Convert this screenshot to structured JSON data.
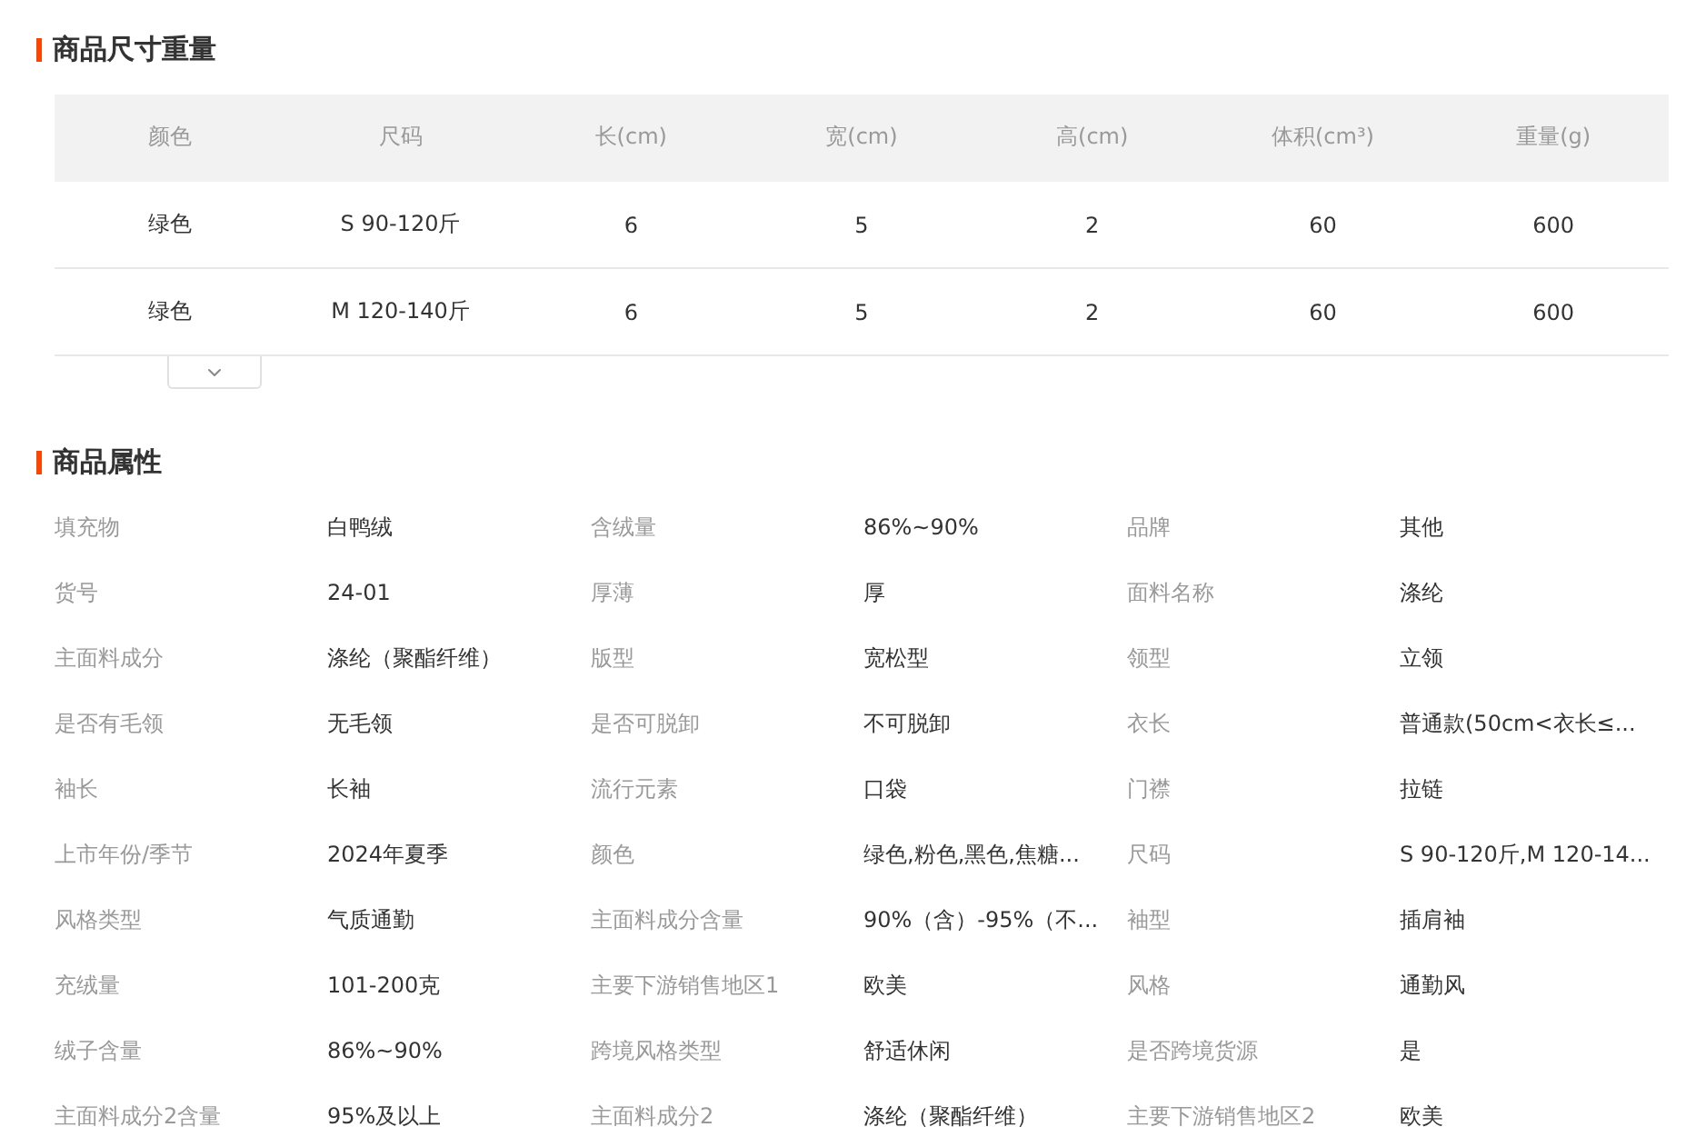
{
  "size_section": {
    "title": "商品尺寸重量",
    "table": {
      "columns": [
        "颜色",
        "尺码",
        "长(cm)",
        "宽(cm)",
        "高(cm)",
        "体积(cm³)",
        "重量(g)"
      ],
      "rows": [
        [
          "绿色",
          "S 90-120斤",
          "6",
          "5",
          "2",
          "60",
          "600"
        ],
        [
          "绿色",
          "M 120-140斤",
          "6",
          "5",
          "2",
          "60",
          "600"
        ]
      ]
    }
  },
  "attributes_section": {
    "title": "商品属性",
    "items": [
      {
        "label": "填充物",
        "value": "白鸭绒"
      },
      {
        "label": "含绒量",
        "value": "86%~90%"
      },
      {
        "label": "品牌",
        "value": "其他"
      },
      {
        "label": "货号",
        "value": "24-01"
      },
      {
        "label": "厚薄",
        "value": "厚"
      },
      {
        "label": "面料名称",
        "value": "涤纶"
      },
      {
        "label": "主面料成分",
        "value": "涤纶（聚酯纤维）"
      },
      {
        "label": "版型",
        "value": "宽松型"
      },
      {
        "label": "领型",
        "value": "立领"
      },
      {
        "label": "是否有毛领",
        "value": "无毛领"
      },
      {
        "label": "是否可脱卸",
        "value": "不可脱卸"
      },
      {
        "label": "衣长",
        "value": "普通款(50cm<衣长≤..."
      },
      {
        "label": "袖长",
        "value": "长袖"
      },
      {
        "label": "流行元素",
        "value": "口袋"
      },
      {
        "label": "门襟",
        "value": "拉链"
      },
      {
        "label": "上市年份/季节",
        "value": "2024年夏季"
      },
      {
        "label": "颜色",
        "value": "绿色,粉色,黑色,焦糖..."
      },
      {
        "label": "尺码",
        "value": "S 90-120斤,M 120-14..."
      },
      {
        "label": "风格类型",
        "value": "气质通勤"
      },
      {
        "label": "主面料成分含量",
        "value": "90%（含）-95%（不..."
      },
      {
        "label": "袖型",
        "value": "插肩袖"
      },
      {
        "label": "充绒量",
        "value": "101-200克"
      },
      {
        "label": "主要下游销售地区1",
        "value": "欧美"
      },
      {
        "label": "风格",
        "value": "通勤风"
      },
      {
        "label": "绒子含量",
        "value": "86%~90%"
      },
      {
        "label": "跨境风格类型",
        "value": "舒适休闲"
      },
      {
        "label": "是否跨境货源",
        "value": "是"
      },
      {
        "label": "主面料成分2含量",
        "value": "95%及以上"
      },
      {
        "label": "主面料成分2",
        "value": "涤纶（聚酯纤维）"
      },
      {
        "label": "主要下游销售地区2",
        "value": "欧美"
      }
    ]
  }
}
